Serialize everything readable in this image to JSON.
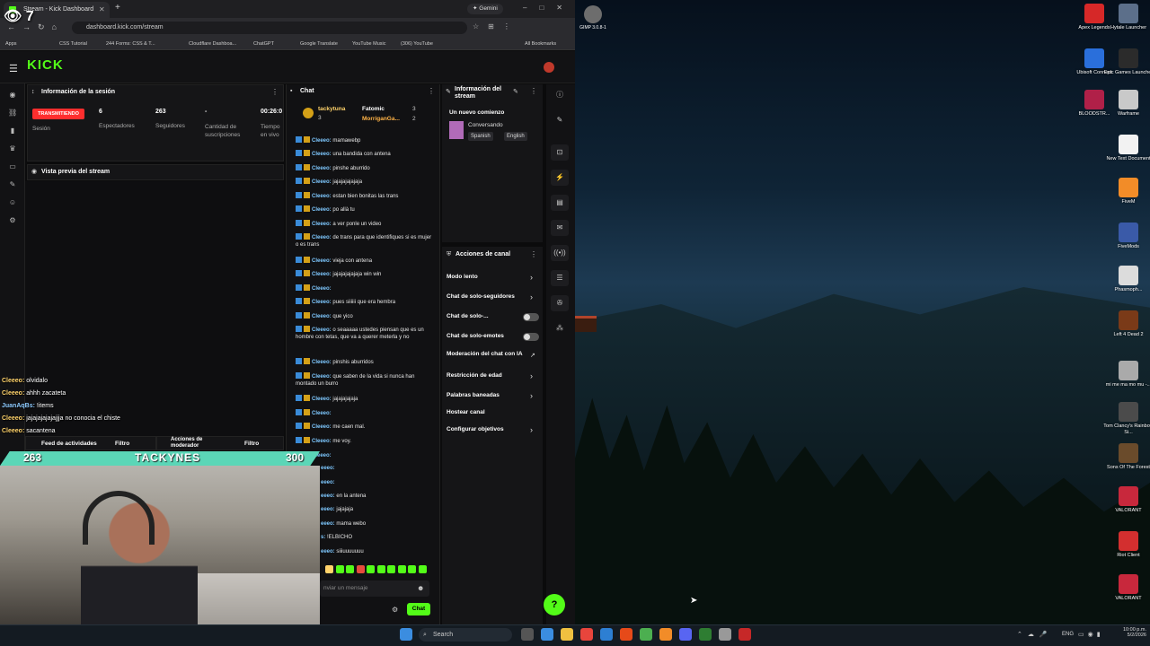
{
  "browser": {
    "tab_title": "Stream - Kick Dashboard",
    "gemini_label": "Gemini",
    "url": "dashboard.kick.com/stream",
    "bookmarks": [
      "Apps",
      "CSS Tutorial",
      "244 Forms: CSS & T...",
      "Cloudflare Dashboa...",
      "ChatGPT",
      "Google Translate",
      "YouTube Music",
      "(306) YouTube"
    ],
    "all_bookmarks": "All Bookmarks"
  },
  "overlay_counter": "7",
  "kick": {
    "logo": "KICK",
    "session": {
      "title": "Información de la sesión",
      "status": "TRANSMITIENDO",
      "session_label": "Sesión",
      "spectators_value": "6",
      "spectators_label": "Espectadores",
      "followers_value": "263",
      "followers_label": "Seguidores",
      "subs_value": "-",
      "subs_label": "Cantidad de suscripciones",
      "time_value": "00:26:0",
      "time_label": "Tiempo en vivo"
    },
    "preview_title": "Vista previa del stream",
    "activity_feed": "Feed de actividades",
    "filter1": "Filtro",
    "mod_actions": "Acciones de moderador",
    "filter2": "Filtro",
    "chat": {
      "title": "Chat",
      "top_users": [
        {
          "name": "tackytuna",
          "count": "3"
        },
        {
          "name": "Fatomic",
          "count": "3"
        },
        {
          "name": "MorriganGa...",
          "count": "2"
        }
      ],
      "messages": [
        {
          "user": "Cleeeo:",
          "text": "mamawebp"
        },
        {
          "user": "Cleeeo:",
          "text": "una bandida con antena"
        },
        {
          "user": "Cleeeo:",
          "text": "pinshe aburrido"
        },
        {
          "user": "Cleeeo:",
          "text": "jajajajajajaja"
        },
        {
          "user": "Cleeeo:",
          "text": "estan bien bonitas las trans"
        },
        {
          "user": "Cleeeo:",
          "text": "po allà tu"
        },
        {
          "user": "Cleeeo:",
          "text": "a ver ponle un video"
        },
        {
          "user": "Cleeeo:",
          "text": "de trans para que identifiques si es mujer o es trans"
        },
        {
          "user": "Cleeeo:",
          "text": "vieja con antena"
        },
        {
          "user": "Cleeeo:",
          "text": "jajajajajajaja win win"
        },
        {
          "user": "Cleeeo:",
          "text": ""
        },
        {
          "user": "Cleeeo:",
          "text": "pues siiiiii que era hembra"
        },
        {
          "user": "Cleeeo:",
          "text": "que yico"
        },
        {
          "user": "Cleeeo:",
          "text": "o seaaaaa ustedes piensan que es un hombre con tetas, que va a querer meterla y no"
        },
        {
          "user": "Cleeeo:",
          "text": "pinshis aburridos"
        },
        {
          "user": "Cleeeo:",
          "text": "que saben de la vida si nunca han montado un burro"
        },
        {
          "user": "Cleeeo:",
          "text": "jajajajajaja"
        },
        {
          "user": "Cleeeo:",
          "text": ""
        },
        {
          "user": "Cleeeo:",
          "text": "me caen mal."
        },
        {
          "user": "Cleeeo:",
          "text": "me voy."
        },
        {
          "user": "Cleeeo:",
          "text": ""
        },
        {
          "user": "eeeo:",
          "text": ""
        },
        {
          "user": "eeeo:",
          "text": ""
        },
        {
          "user": "eeeo:",
          "text": "en la antena"
        },
        {
          "user": "eeeo:",
          "text": "jajajaja"
        },
        {
          "user": "eeeo:",
          "text": "mama webo"
        },
        {
          "user": "s:",
          "text": "!ELBICHO"
        },
        {
          "user": "eeeo:",
          "text": "siiiuuuuuuu"
        }
      ],
      "placeholder": "nviar un mensaje",
      "send": "Chat"
    },
    "stream_info": {
      "title": "Información del stream",
      "stream_title": "Un nuevo comienzo",
      "category": "Conversando",
      "tags": [
        "Spanish",
        "English"
      ]
    },
    "channel_actions": {
      "title": "Acciones de canal",
      "items": [
        {
          "label": "Modo lento",
          "control": "chevron"
        },
        {
          "label": "Chat de solo-seguidores",
          "control": "chevron"
        },
        {
          "label": "Chat de solo-...",
          "control": "toggle"
        },
        {
          "label": "Chat de solo-emotes",
          "control": "toggle"
        },
        {
          "label": "Moderación del chat con IA",
          "control": "external"
        },
        {
          "label": "Restricción de edad",
          "control": "chevron"
        },
        {
          "label": "Palabras baneadas",
          "control": "chevron"
        },
        {
          "label": "Hostear canal",
          "control": "none"
        },
        {
          "label": "Configurar objetivos",
          "control": "chevron"
        }
      ]
    }
  },
  "stream_overlay": {
    "chat_lines": [
      {
        "user": "Cleeeo:",
        "text": "olvidalo"
      },
      {
        "user": "Cleeeo:",
        "text": "ahhh zacateta"
      },
      {
        "user": "JuanAqBs:",
        "text": "!items"
      },
      {
        "user": "Cleeeo:",
        "text": "jajajajajajajjja no conocia el chiste"
      },
      {
        "user": "Cleeeo:",
        "text": "sacantena"
      }
    ],
    "score_left": "263",
    "streamer_name": "TACKYNES",
    "score_right": "300"
  },
  "desktop": {
    "gimp_label": "GIMP 3.0.8-1",
    "icons": [
      {
        "label": "Apex Legends",
        "color": "#d62828"
      },
      {
        "label": "Hytale Launcher",
        "color": "#5c6f8a"
      },
      {
        "label": "Ubisoft Connect",
        "color": "#2a6fdb"
      },
      {
        "label": "Epic Games Launcher",
        "color": "#2b2b2b"
      },
      {
        "label": "BLOODSTR...",
        "color": "#b02048"
      },
      {
        "label": "Warframe",
        "color": "#c9c9c9"
      },
      {
        "label": "New Text Document",
        "color": "#f2f2f2"
      },
      {
        "label": "FiveM",
        "color": "#f28c28"
      },
      {
        "label": "FiveMods",
        "color": "#3a5aa8"
      },
      {
        "label": "Phasmoph...",
        "color": "#dcdcdc"
      },
      {
        "label": "Left 4 Dead 2",
        "color": "#7a3a18"
      },
      {
        "label": "mi me ma mo mu -...",
        "color": "#aaaaaa"
      },
      {
        "label": "Tom Clancy's Rainbow Si...",
        "color": "#4b4b4b"
      },
      {
        "label": "Sons Of The Forest",
        "color": "#6a4b2b"
      },
      {
        "label": "VALORANT",
        "color": "#c8283c"
      },
      {
        "label": "Riot Client",
        "color": "#d32f2f"
      },
      {
        "label": "VALORANT",
        "color": "#c8283c"
      }
    ]
  },
  "taskbar": {
    "search": "Search",
    "lang": "ENG",
    "time": "10:00 p.m.",
    "date": "5/2/2026"
  }
}
